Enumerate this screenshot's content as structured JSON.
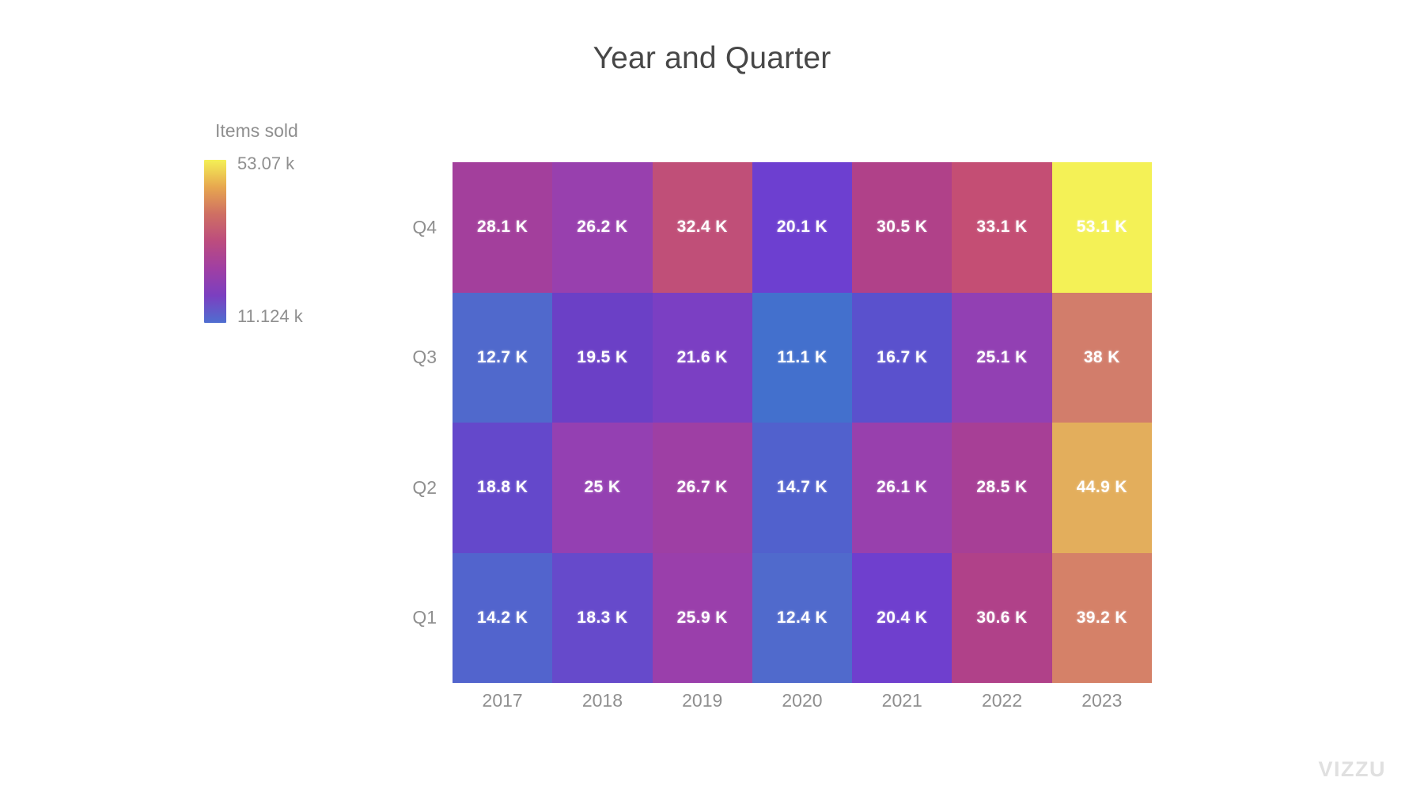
{
  "chart_data": {
    "type": "heatmap",
    "title": "Year and Quarter",
    "xlabel": "",
    "ylabel": "",
    "categories": [
      "2017",
      "2018",
      "2019",
      "2020",
      "2021",
      "2022",
      "2023"
    ],
    "rows": [
      "Q4",
      "Q3",
      "Q2",
      "Q1"
    ],
    "legend": {
      "title": "Items sold",
      "max_label": "53.07 k",
      "min_label": "11.124 k",
      "max_value": 53070,
      "min_value": 11124,
      "position": "left",
      "gradient_stops": [
        "#f4f056",
        "#e7a74f",
        "#cf6f63",
        "#bc4c7e",
        "#a03fa3",
        "#7b3fc0",
        "#4f6ed0"
      ]
    },
    "grid": false,
    "series": [
      {
        "name": "Q4",
        "cells": [
          {
            "x": "2017",
            "label": "28.1 K",
            "value": 28100,
            "color": "#a33f9c"
          },
          {
            "x": "2018",
            "label": "26.2 K",
            "value": 26200,
            "color": "#9840ae"
          },
          {
            "x": "2019",
            "label": "32.4 K",
            "value": 32400,
            "color": "#c04f78"
          },
          {
            "x": "2020",
            "label": "20.1 K",
            "value": 20100,
            "color": "#6d3fd0"
          },
          {
            "x": "2021",
            "label": "30.5 K",
            "value": 30500,
            "color": "#b04189"
          },
          {
            "x": "2022",
            "label": "33.1 K",
            "value": 33100,
            "color": "#c44e74"
          },
          {
            "x": "2023",
            "label": "53.1 K",
            "value": 53100,
            "color": "#f4f156"
          }
        ]
      },
      {
        "name": "Q3",
        "cells": [
          {
            "x": "2017",
            "label": "12.7 K",
            "value": 12700,
            "color": "#5069cc"
          },
          {
            "x": "2018",
            "label": "19.5 K",
            "value": 19500,
            "color": "#6b40c6"
          },
          {
            "x": "2019",
            "label": "21.6 K",
            "value": 21600,
            "color": "#7b3fc3"
          },
          {
            "x": "2020",
            "label": "11.1 K",
            "value": 11100,
            "color": "#4370cd"
          },
          {
            "x": "2021",
            "label": "16.7 K",
            "value": 16700,
            "color": "#5a51cd"
          },
          {
            "x": "2022",
            "label": "25.1 K",
            "value": 25100,
            "color": "#9240b3"
          },
          {
            "x": "2023",
            "label": "38 K",
            "value": 38000,
            "color": "#d27d6b"
          }
        ]
      },
      {
        "name": "Q2",
        "cells": [
          {
            "x": "2017",
            "label": "18.8 K",
            "value": 18800,
            "color": "#6448cb"
          },
          {
            "x": "2018",
            "label": "25 K",
            "value": 25000,
            "color": "#9440b2"
          },
          {
            "x": "2019",
            "label": "26.7 K",
            "value": 26700,
            "color": "#9e3fa4"
          },
          {
            "x": "2020",
            "label": "14.7 K",
            "value": 14700,
            "color": "#5161cd"
          },
          {
            "x": "2021",
            "label": "26.1 K",
            "value": 26100,
            "color": "#9840ad"
          },
          {
            "x": "2022",
            "label": "28.5 K",
            "value": 28500,
            "color": "#a73f96"
          },
          {
            "x": "2023",
            "label": "44.9 K",
            "value": 44900,
            "color": "#e3ae5c"
          }
        ]
      },
      {
        "name": "Q1",
        "cells": [
          {
            "x": "2017",
            "label": "14.2 K",
            "value": 14200,
            "color": "#5264cd"
          },
          {
            "x": "2018",
            "label": "18.3 K",
            "value": 18300,
            "color": "#664acb"
          },
          {
            "x": "2019",
            "label": "25.9 K",
            "value": 25900,
            "color": "#9a3fab"
          },
          {
            "x": "2020",
            "label": "12.4 K",
            "value": 12400,
            "color": "#506acc"
          },
          {
            "x": "2021",
            "label": "20.4 K",
            "value": 20400,
            "color": "#6f3fce"
          },
          {
            "x": "2022",
            "label": "30.6 K",
            "value": 30600,
            "color": "#b04189"
          },
          {
            "x": "2023",
            "label": "39.2 K",
            "value": 39200,
            "color": "#d58168"
          }
        ]
      }
    ]
  },
  "watermark": "VIZZU"
}
